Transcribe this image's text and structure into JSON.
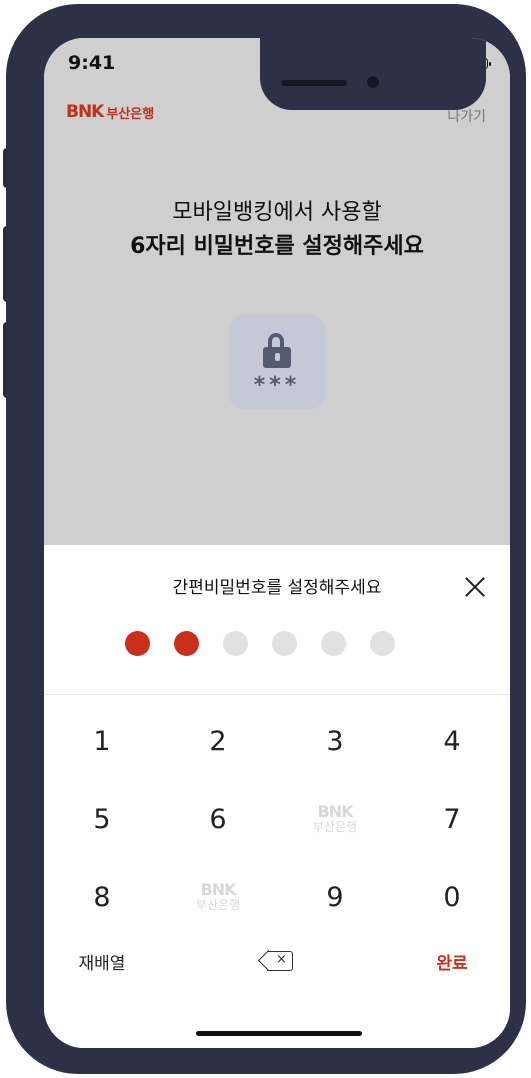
{
  "status_bar": {
    "time": "9:41"
  },
  "header": {
    "logo_text": "BNK",
    "bank_name": "부산은행",
    "exit_label": "나가기"
  },
  "headline": {
    "line1": "모바일뱅킹에서 사용할",
    "line2": "6자리 비밀번호를 설정해주세요"
  },
  "lock_icon": {
    "name": "password-lock-icon",
    "stars": "***"
  },
  "sheet": {
    "title": "간편비밀번호를 설정해주세요",
    "pin_length": 6,
    "pin_entered": 2,
    "accent_color": "#c9301b"
  },
  "keypad": {
    "row1": [
      "1",
      "2",
      "3",
      "4"
    ],
    "row2": [
      "5",
      "6",
      "BNK 부산은행",
      "7"
    ],
    "row3": [
      "8",
      "BNK 부산은행",
      "9",
      "0"
    ],
    "shuffle_label": "재배열",
    "done_label": "완료",
    "watermark_logo": "BNK",
    "watermark_bank": "부산은행"
  }
}
